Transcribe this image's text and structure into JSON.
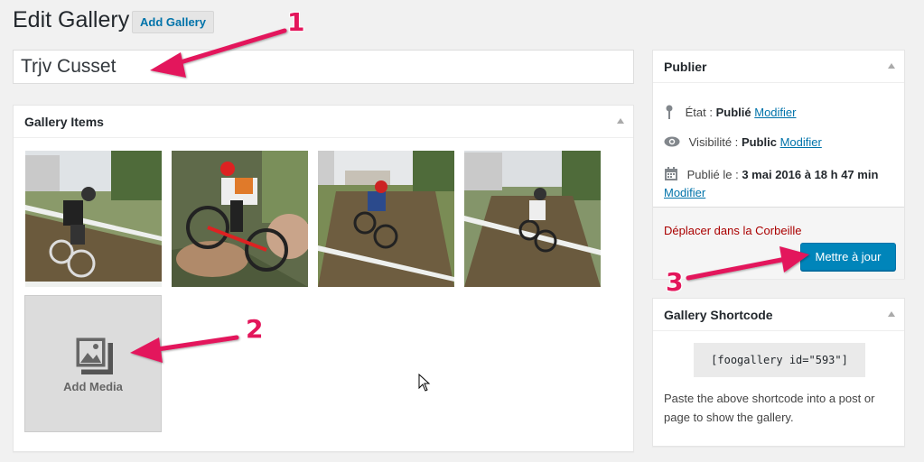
{
  "header": {
    "title": "Edit Gallery",
    "add_button": "Add Gallery"
  },
  "gallery_title": {
    "value": "Trjv Cusset"
  },
  "gallery_items": {
    "heading": "Gallery Items",
    "thumbnails": [
      {
        "alt": "cyclist-photo-1"
      },
      {
        "alt": "cyclist-photo-2"
      },
      {
        "alt": "cyclist-photo-3"
      },
      {
        "alt": "cyclist-photo-4"
      }
    ],
    "add_media_label": "Add Media"
  },
  "publish": {
    "heading": "Publier",
    "status_label": "État :",
    "status_value": "Publié",
    "status_link": "Modifier",
    "visibility_label": "Visibilité :",
    "visibility_value": "Public",
    "visibility_link": "Modifier",
    "published_label": "Publié le :",
    "published_value": "3 mai 2016 à 18 h 47 min",
    "published_link": "Modifier",
    "trash_link": "Déplacer dans la Corbeille",
    "update_button": "Mettre à jour"
  },
  "shortcode": {
    "heading": "Gallery Shortcode",
    "code": "[foogallery id=\"593\"]",
    "help": "Paste the above shortcode into a post or page to show the gallery."
  },
  "annotations": {
    "labels": [
      "1",
      "2",
      "3"
    ],
    "color": "#e3165b"
  },
  "colors": {
    "link": "#0073aa",
    "primary_button": "#0085ba",
    "trash": "#a00000",
    "background": "#f1f1f1"
  }
}
